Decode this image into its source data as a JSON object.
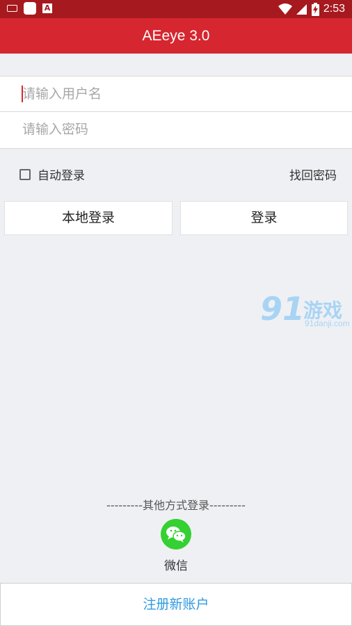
{
  "status_bar": {
    "time": "2:53",
    "battery_icon": "battery-charging-icon",
    "wifi_icon": "wifi-icon",
    "signal_icon": "signal-icon",
    "notification_letter": "A"
  },
  "app_bar": {
    "title": "AEeye 3.0",
    "color": "#d6262f"
  },
  "login_form": {
    "username": {
      "value": "",
      "placeholder": "请输入用户名"
    },
    "password": {
      "value": "",
      "placeholder": "请输入密码"
    },
    "auto_login_label": "自动登录",
    "auto_login_checked": false,
    "forgot_password": "找回密码"
  },
  "buttons": {
    "local_login": "本地登录",
    "login": "登录"
  },
  "watermark": {
    "number": "91",
    "text": "游戏",
    "url": "91danji.com"
  },
  "other_login": {
    "label": "---------其他方式登录---------",
    "wechat_label": "微信",
    "wechat_color": "#35d032"
  },
  "register": {
    "label": "注册新账户",
    "color": "#2f9ae0"
  }
}
